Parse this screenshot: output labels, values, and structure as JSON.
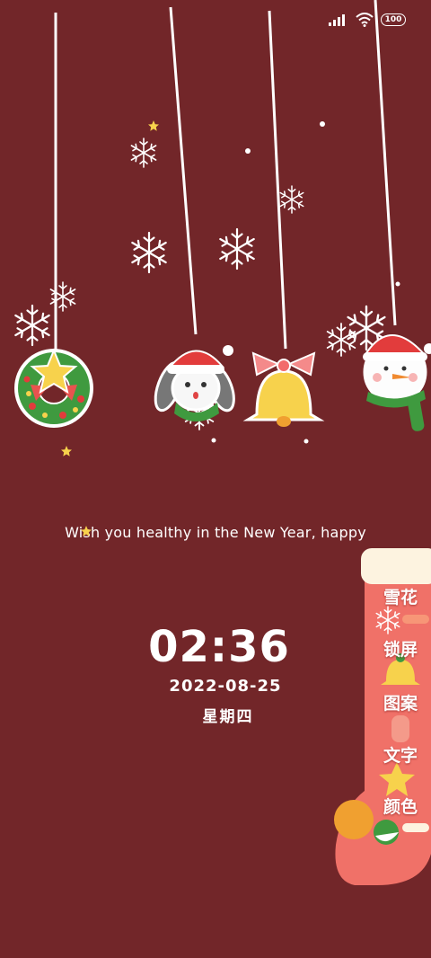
{
  "status_bar": {
    "signal_icon": "signal-icon",
    "wifi_icon": "wifi-icon",
    "battery_level": "100"
  },
  "ornaments": [
    "wreath",
    "bunny-santa",
    "bell",
    "snowman"
  ],
  "wish_text": "Wish you healthy in the New Year, happy",
  "clock": {
    "time": "02:36",
    "date": "2022-08-25",
    "weekday": "星期四"
  },
  "side_menu": {
    "items": [
      {
        "label": "雪花"
      },
      {
        "label": "锁屏"
      },
      {
        "label": "图案"
      },
      {
        "label": "文字"
      },
      {
        "label": "颜色"
      }
    ]
  },
  "colors": {
    "background": "#722629",
    "stocking": "#f07168",
    "stocking_cuff": "#fdf3e0"
  }
}
